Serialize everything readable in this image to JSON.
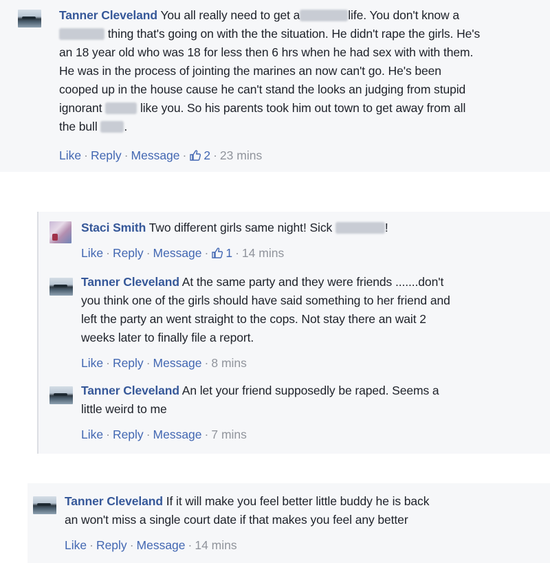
{
  "comments": [
    {
      "author": "Tanner Cleveland",
      "lines": [
        [
          "You all really need to get a",
          "life. You don't know a"
        ],
        [
          "",
          "thing that's going on with the the situation. He didn't rape the girls. He's"
        ],
        [
          "an 18 year old who was 18 for less then 6 hrs when he had sex with with them."
        ],
        [
          "He was in the process of jointing the marines an now can't go. He's been"
        ],
        [
          "cooped up in the house cause he can't stand the looks an judging from stupid"
        ],
        [
          "ignorant",
          "like you. So his parents took him out town to get away from all"
        ],
        [
          "the bull",
          "."
        ]
      ],
      "actions": {
        "like": "Like",
        "reply": "Reply",
        "message": "Message",
        "likes": "2",
        "time": "23 mins"
      }
    },
    {
      "author": "Staci Smith",
      "lines": [
        [
          "Two different girls same night! Sick",
          "!"
        ]
      ],
      "actions": {
        "like": "Like",
        "reply": "Reply",
        "message": "Message",
        "likes": "1",
        "time": "14 mins"
      }
    },
    {
      "author": "Tanner Cleveland",
      "lines": [
        [
          "At the same party and they were friends .......don't"
        ],
        [
          "you think one of the girls should have said something to her friend and"
        ],
        [
          "left the party an went straight to the cops. Not stay there an wait 2"
        ],
        [
          "weeks later to finally file a report."
        ]
      ],
      "actions": {
        "like": "Like",
        "reply": "Reply",
        "message": "Message",
        "time": "8 mins"
      }
    },
    {
      "author": "Tanner Cleveland",
      "lines": [
        [
          "An let your friend supposedly be raped. Seems a"
        ],
        [
          "little weird to me"
        ]
      ],
      "actions": {
        "like": "Like",
        "reply": "Reply",
        "message": "Message",
        "time": "7 mins"
      }
    },
    {
      "author": "Tanner Cleveland",
      "lines": [
        [
          "If it will make you feel better little buddy he is back"
        ],
        [
          "an won't miss a single court date if that makes you feel any better"
        ]
      ],
      "actions": {
        "like": "Like",
        "reply": "Reply",
        "message": "Message",
        "time": "14 mins"
      }
    }
  ]
}
